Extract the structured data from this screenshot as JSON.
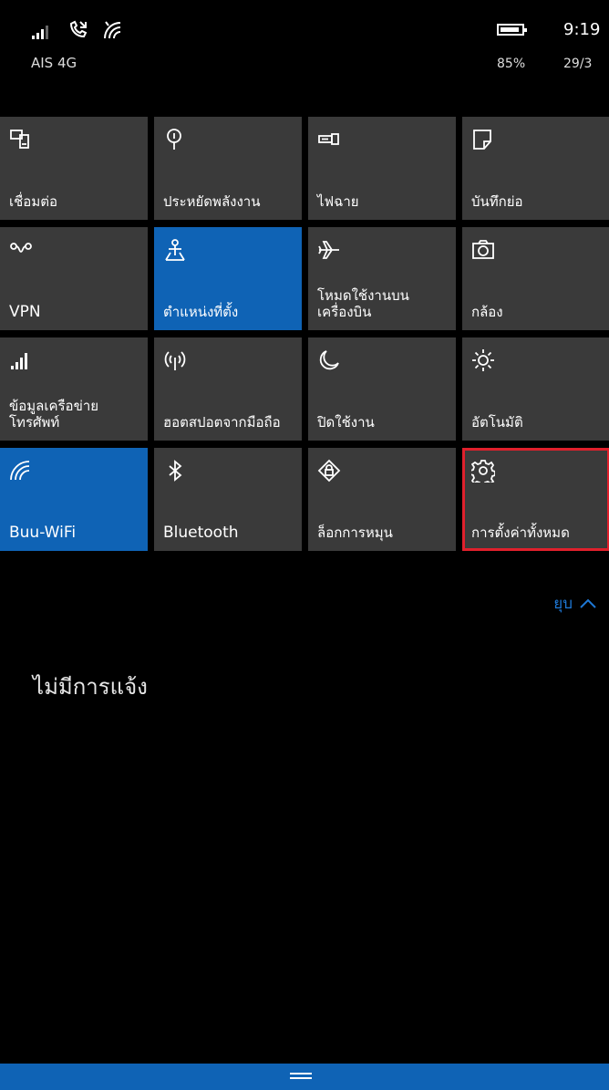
{
  "status_bar": {
    "carrier": "AIS 4G",
    "time": "9:19",
    "battery_percent": "85%",
    "date": "29/3",
    "icons": [
      "signal-icon",
      "call-forward-icon",
      "wifi-icon",
      "battery-icon"
    ]
  },
  "quick_actions": [
    {
      "label": "เชื่อมต่อ",
      "icon": "connect-icon",
      "on": false
    },
    {
      "label": "ประหยัดพลังงาน",
      "icon": "battery-saver-icon",
      "on": false
    },
    {
      "label": "ไฟฉาย",
      "icon": "flashlight-icon",
      "on": false
    },
    {
      "label": "บันทึกย่อ",
      "icon": "note-icon",
      "on": false
    },
    {
      "label": "VPN",
      "icon": "vpn-icon",
      "on": false
    },
    {
      "label": "ตำแหน่งที่ตั้ง",
      "icon": "location-icon",
      "on": true
    },
    {
      "label": "โหมดใช้งานบนเครื่องบิน",
      "icon": "airplane-icon",
      "on": false
    },
    {
      "label": "กล้อง",
      "icon": "camera-icon",
      "on": false
    },
    {
      "label": "ข้อมูลเครือข่ายโทรศัพท์",
      "icon": "cellular-data-icon",
      "on": false
    },
    {
      "label": "ฮอตสปอตจากมือถือ",
      "icon": "hotspot-icon",
      "on": false
    },
    {
      "label": "ปิดใช้งาน",
      "icon": "quiet-hours-icon",
      "on": false
    },
    {
      "label": "อัตโนมัติ",
      "icon": "brightness-icon",
      "on": false
    },
    {
      "label": "Buu-WiFi",
      "icon": "wifi-icon",
      "on": true
    },
    {
      "label": "Bluetooth",
      "icon": "bluetooth-icon",
      "on": false
    },
    {
      "label": "ล็อกการหมุน",
      "icon": "rotation-lock-icon",
      "on": false
    },
    {
      "label": "การตั้งค่าทั้งหมด",
      "icon": "settings-gear-icon",
      "on": false
    }
  ],
  "collapse": {
    "label": "ยุบ"
  },
  "notifications": {
    "empty_text": "ไม่มีการแจ้ง"
  },
  "colors": {
    "accent": "#0f63b5",
    "tile": "#3a3a3a",
    "highlight": "#e0202c"
  }
}
